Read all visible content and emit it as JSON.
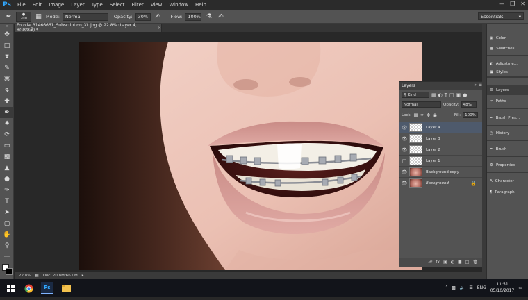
{
  "app": {
    "logo": "Ps"
  },
  "menu": [
    "File",
    "Edit",
    "Image",
    "Layer",
    "Type",
    "Select",
    "Filter",
    "View",
    "Window",
    "Help"
  ],
  "options_bar": {
    "brush_size": "200",
    "mode_label": "Mode:",
    "mode_value": "Normal",
    "opacity_label": "Opacity:",
    "opacity_value": "30%",
    "flow_label": "Flow:",
    "flow_value": "100%",
    "workspace": "Essentials"
  },
  "document": {
    "tab_title": "Fotolia_31466661_Subscription_XL.jpg @ 22.8% (Layer 4, RGB/8#) *",
    "zoom": "22.8%",
    "doc_info": "Doc: 20.8M/66.0M"
  },
  "layers_panel": {
    "tab": "Layers",
    "filter_label": "Kind",
    "blend_mode": "Normal",
    "opacity_label": "Opacity:",
    "opacity_value": "48%",
    "lock_label": "Lock:",
    "fill_label": "Fill:",
    "fill_value": "100%",
    "layers": [
      {
        "name": "Layer 4",
        "visible": true
      },
      {
        "name": "Layer 3",
        "visible": true
      },
      {
        "name": "Layer 2",
        "visible": true
      },
      {
        "name": "Layer 1",
        "visible": false
      },
      {
        "name": "Background copy",
        "visible": true
      },
      {
        "name": "Background",
        "visible": true
      }
    ],
    "selected": "Layer 4"
  },
  "dock": {
    "items": [
      "Color",
      "Swatches",
      "Adjustme...",
      "Styles",
      "Layers",
      "Paths",
      "Brush Pres...",
      "History",
      "Brush",
      "Properties",
      "Character",
      "Paragraph"
    ],
    "active": "Layers"
  },
  "taskbar": {
    "language": "ENG",
    "time": "11:51",
    "date": "05/10/2017"
  },
  "colors": {
    "ps_blue": "#31a8ff",
    "panel_gray": "#535353",
    "selection": "#4e5a6c"
  }
}
